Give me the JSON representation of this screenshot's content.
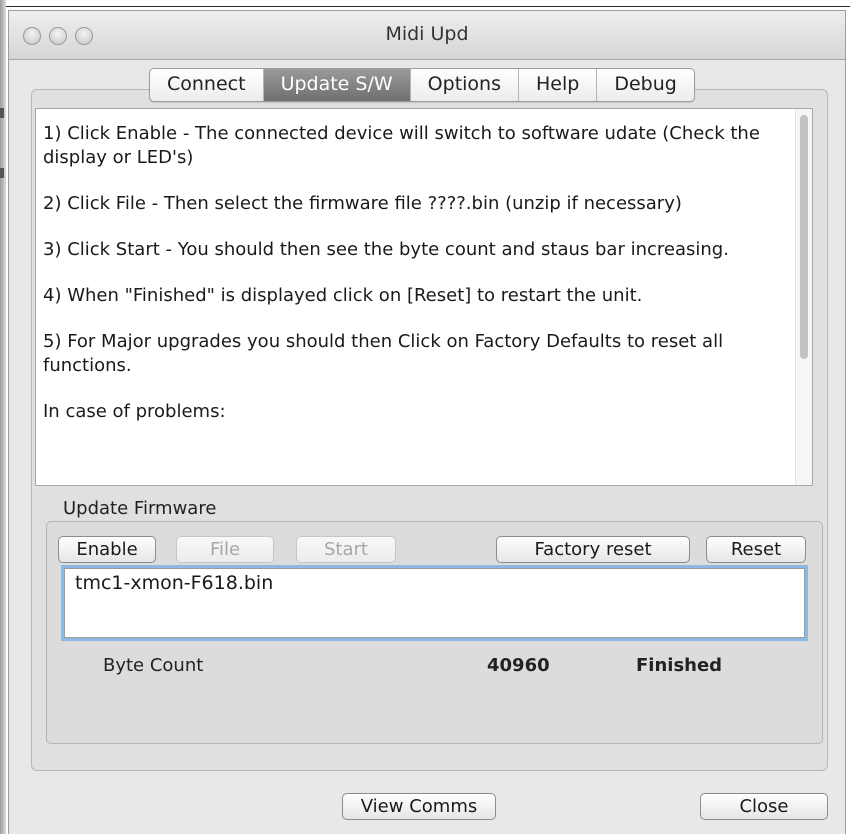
{
  "window": {
    "title": "Midi  Upd"
  },
  "tabs": [
    {
      "label": "Connect",
      "active": false
    },
    {
      "label": "Update S/W",
      "active": true
    },
    {
      "label": "Options",
      "active": false
    },
    {
      "label": "Help",
      "active": false
    },
    {
      "label": "Debug",
      "active": false
    }
  ],
  "instructions": [
    "1) Click Enable - The connected device will switch to software udate (Check the display or LED's)",
    "2) Click File - Then select the firmware file ????.bin (unzip if necessary)",
    "3) Click Start - You should then see the byte count and staus bar increasing.",
    "4) When \"Finished\" is displayed click on [Reset] to restart the unit.",
    "5) For Major upgrades you should then Click on Factory Defaults to reset all functions.",
    "In case of problems:"
  ],
  "update": {
    "group_label": "Update Firmware",
    "enable_label": "Enable",
    "file_label": "File",
    "start_label": "Start",
    "factory_reset_label": "Factory reset",
    "reset_label": "Reset",
    "filename": "tmc1-xmon-F618.bin",
    "byte_count_label": "Byte Count",
    "byte_count_value": "40960",
    "status": "Finished"
  },
  "footer": {
    "view_comms_label": "View Comms",
    "close_label": "Close"
  },
  "icons": {
    "close": "close-traffic-light-icon",
    "minimize": "minimize-traffic-light-icon",
    "zoom": "zoom-traffic-light-icon"
  },
  "colors": {
    "active_tab": "#7f7f7f",
    "focus_ring": "#8fb7e3"
  }
}
